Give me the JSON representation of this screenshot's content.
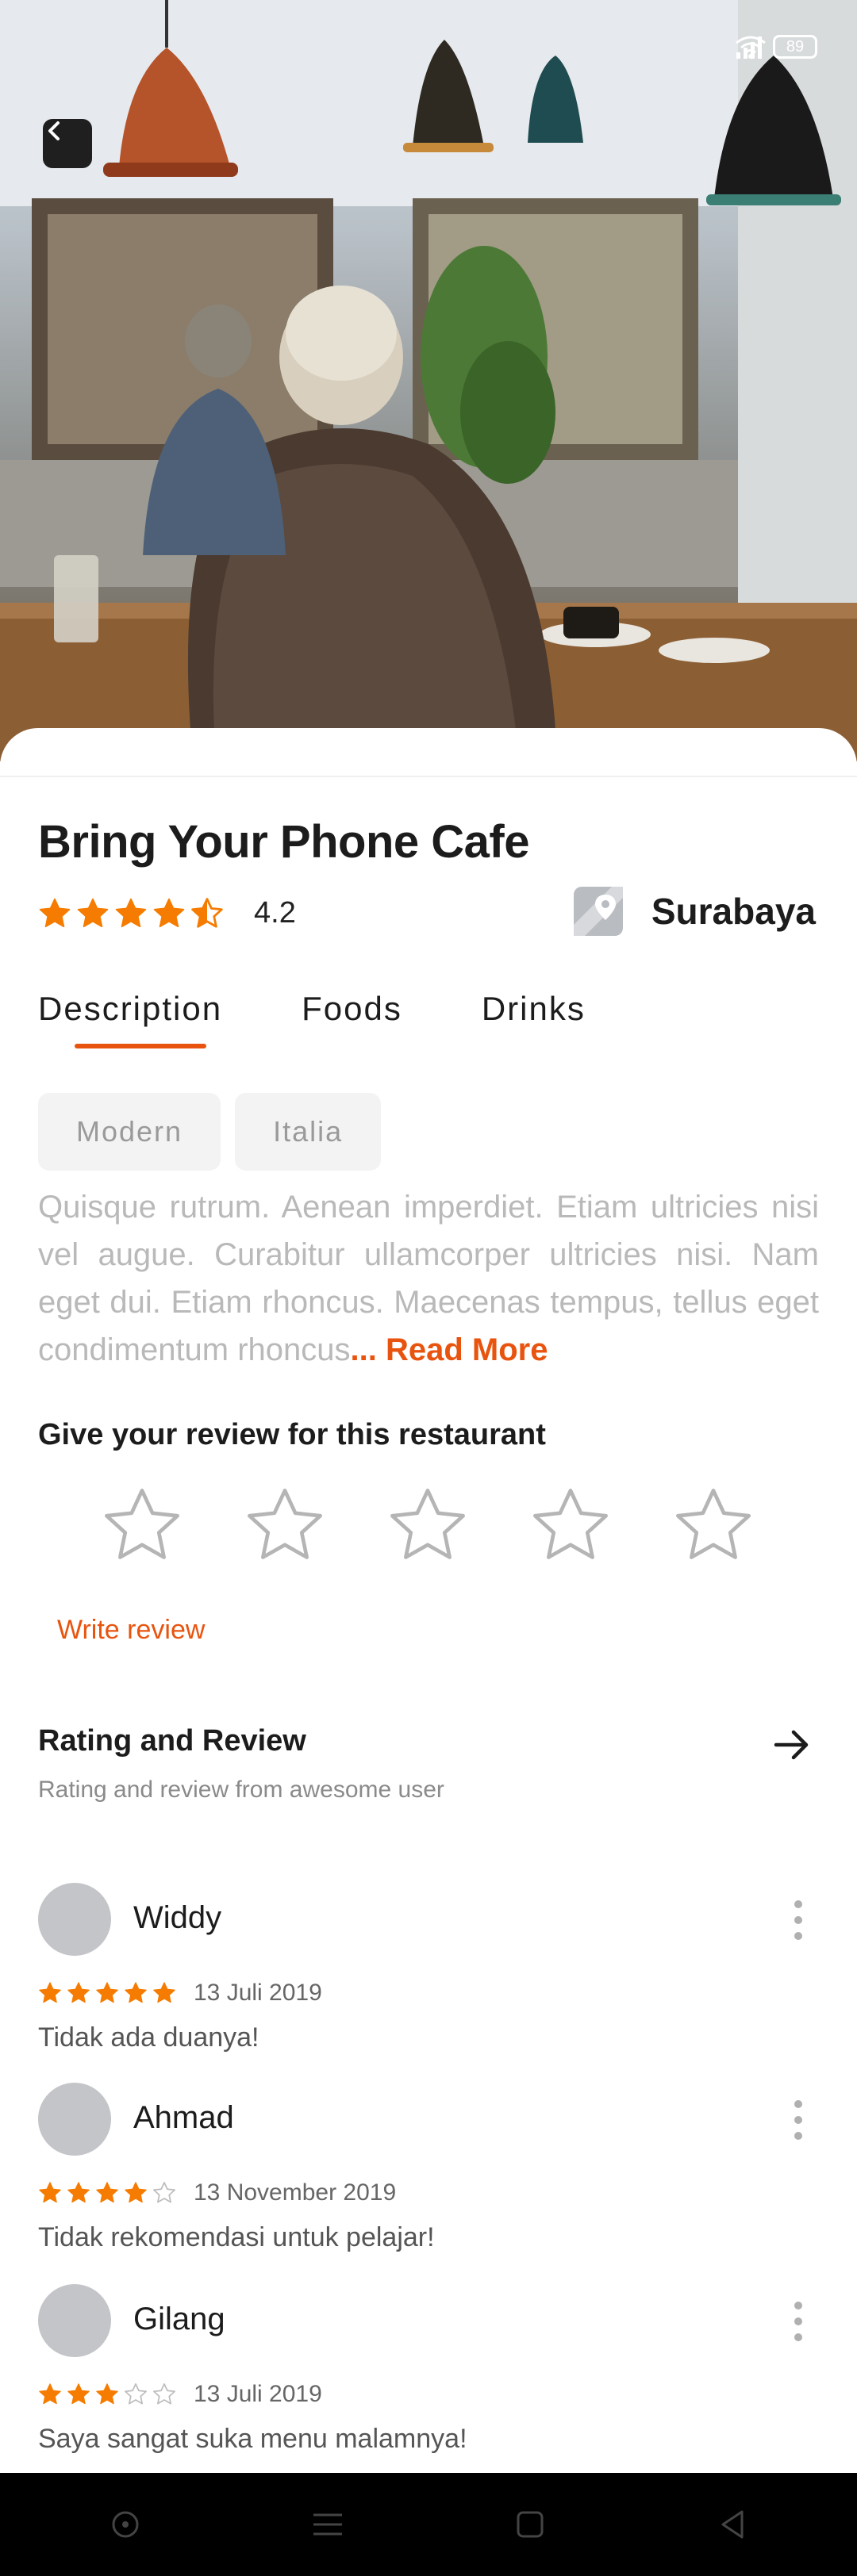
{
  "status_bar": {
    "battery": "89"
  },
  "header": {
    "back_icon": "chevron-left-icon"
  },
  "restaurant": {
    "name": "Bring Your Phone Cafe",
    "rating": "4.2",
    "rating_stars": 4.5,
    "location": "Surabaya",
    "location_icon": "map-pin-icon"
  },
  "tabs": [
    {
      "label": "Description",
      "active": true
    },
    {
      "label": "Foods",
      "active": false
    },
    {
      "label": "Drinks",
      "active": false
    }
  ],
  "tags": [
    "Modern",
    "Italia"
  ],
  "description": {
    "text": "Quisque rutrum. Aenean imperdiet. Etiam ultricies nisi vel augue. Curabitur ullamcorper ultricies nisi. Nam eget dui. Etiam rhoncus. Maecenas tempus, tellus eget condimentum rhoncus",
    "read_more": "... Read More"
  },
  "review_input": {
    "prompt": "Give your review for this restaurant",
    "star_count": 5,
    "write_review": "Write review"
  },
  "rating_section": {
    "title": "Rating and Review",
    "subtitle": "Rating and review from awesome user",
    "arrow_icon": "arrow-right-icon"
  },
  "reviews": [
    {
      "name": "Widdy",
      "stars": 5,
      "date": "13 Juli 2019",
      "text": "Tidak ada duanya!"
    },
    {
      "name": "Ahmad",
      "stars": 4,
      "date": "13 November 2019",
      "text": "Tidak rekomendasi untuk pelajar!"
    },
    {
      "name": "Gilang",
      "stars": 3,
      "date": "13 Juli 2019",
      "text": "Saya sangat suka menu malamnya!"
    }
  ],
  "colors": {
    "accent": "#e8540f",
    "star": "#f57c00",
    "star_empty": "#bdbdbd",
    "text": "#1c1c1c",
    "muted": "#b9b9b9"
  },
  "navbar": {
    "icons": [
      "circle-icon",
      "menu-icon",
      "square-icon",
      "back-triangle-icon"
    ]
  }
}
